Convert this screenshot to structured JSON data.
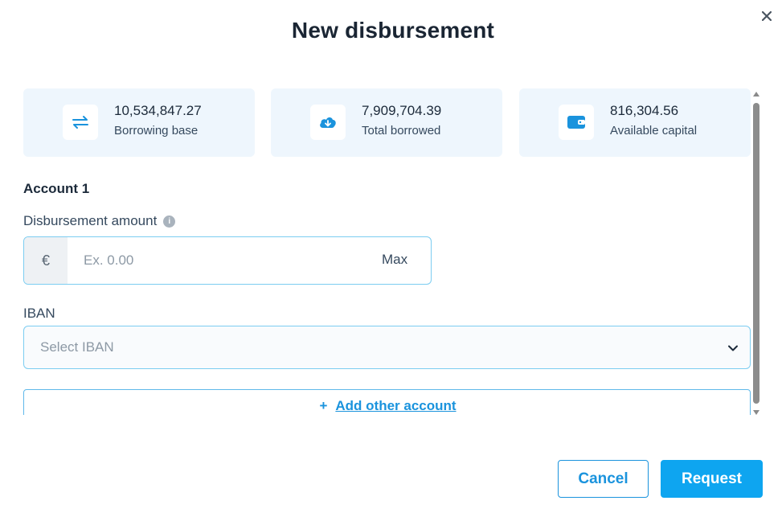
{
  "dialog": {
    "title": "New disbursement",
    "close_icon": "close-icon"
  },
  "stats": [
    {
      "value": "10,534,847.27",
      "label": "Borrowing base",
      "icon": "swap-arrows-icon"
    },
    {
      "value": "7,909,704.39",
      "label": "Total borrowed",
      "icon": "download-cloud-icon"
    },
    {
      "value": "816,304.56",
      "label": "Available capital",
      "icon": "wallet-icon"
    }
  ],
  "account": {
    "title": "Account 1",
    "amount_label": "Disbursement amount",
    "info_icon": "info-icon",
    "currency_symbol": "€",
    "amount_placeholder": "Ex. 0.00",
    "amount_value": "",
    "max_label": "Max",
    "iban_label": "IBAN",
    "iban_placeholder": "Select IBAN"
  },
  "add_account": {
    "plus": "+",
    "label": "Add other account"
  },
  "footer": {
    "cancel_label": "Cancel",
    "request_label": "Request"
  },
  "colors": {
    "accent": "#1a93dd",
    "primary_button": "#0ea5f0",
    "card_background": "#eef6fd",
    "input_border": "#7ccdf1"
  }
}
